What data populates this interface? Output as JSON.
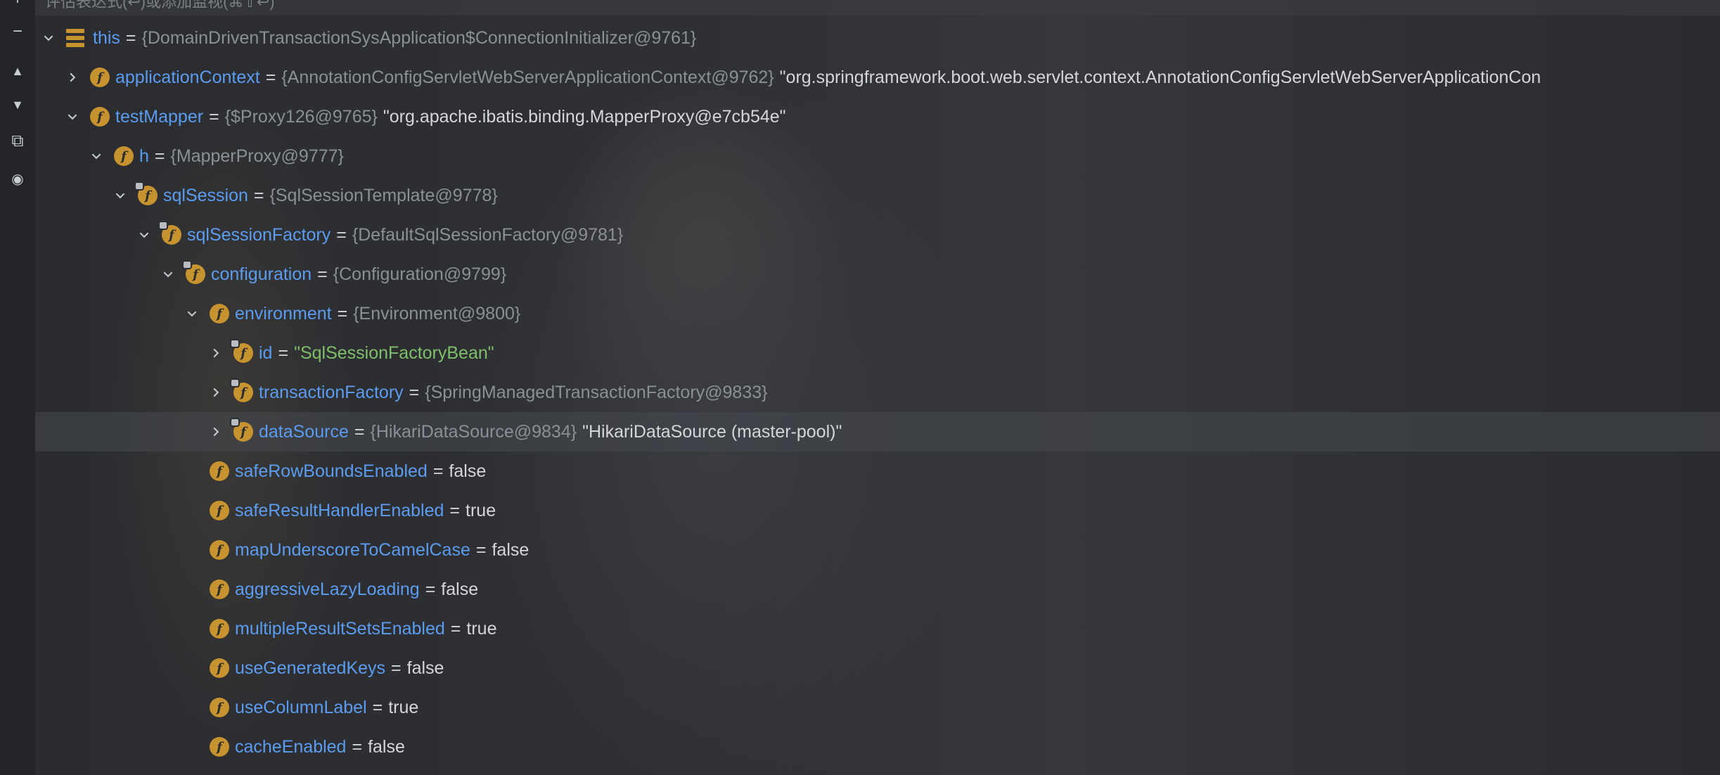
{
  "header": {
    "text": "评估表达式(↩)或添加监视(⌘⇧↩)"
  },
  "toolbar": {
    "items": [
      {
        "name": "add-watch-button",
        "glyph": "+"
      },
      {
        "name": "remove-watch-button",
        "glyph": "−"
      },
      {
        "name": "move-up-button",
        "glyph": "▲"
      },
      {
        "name": "move-down-button",
        "glyph": "▼"
      },
      {
        "name": "duplicate-watch-button",
        "glyph": "⧉"
      },
      {
        "name": "view-options-button",
        "glyph": "◉"
      }
    ]
  },
  "tree": {
    "rows": [
      {
        "depth": 0,
        "chevron": "down",
        "icon": "stack",
        "name": "this",
        "eq": "=",
        "ref": "{DomainDrivenTransactionSysApplication$ConnectionInitializer@9761}",
        "str": "",
        "desc": ""
      },
      {
        "depth": 1,
        "chevron": "right",
        "icon": "field",
        "name": "applicationContext",
        "eq": "=",
        "ref": "{AnnotationConfigServletWebServerApplicationContext@9762}",
        "str": "",
        "desc": "\"org.springframework.boot.web.servlet.context.AnnotationConfigServletWebServerApplicationCon"
      },
      {
        "depth": 1,
        "chevron": "down",
        "icon": "field",
        "name": "testMapper",
        "eq": "=",
        "ref": "{$Proxy126@9765}",
        "str": "",
        "desc": "\"org.apache.ibatis.binding.MapperProxy@e7cb54e\""
      },
      {
        "depth": 2,
        "chevron": "down",
        "icon": "field",
        "name": "h",
        "eq": "=",
        "ref": "{MapperProxy@9777}",
        "str": "",
        "desc": ""
      },
      {
        "depth": 3,
        "chevron": "down",
        "icon": "field-locked",
        "name": "sqlSession",
        "eq": "=",
        "ref": "{SqlSessionTemplate@9778}",
        "str": "",
        "desc": ""
      },
      {
        "depth": 4,
        "chevron": "down",
        "icon": "field-locked",
        "name": "sqlSessionFactory",
        "eq": "=",
        "ref": "{DefaultSqlSessionFactory@9781}",
        "str": "",
        "desc": ""
      },
      {
        "depth": 5,
        "chevron": "down",
        "icon": "field-locked",
        "name": "configuration",
        "eq": "=",
        "ref": "{Configuration@9799}",
        "str": "",
        "desc": ""
      },
      {
        "depth": 6,
        "chevron": "down",
        "icon": "field",
        "name": "environment",
        "eq": "=",
        "ref": "{Environment@9800}",
        "str": "",
        "desc": ""
      },
      {
        "depth": 7,
        "chevron": "right",
        "icon": "field-locked",
        "name": "id",
        "eq": "=",
        "ref": "",
        "str": "\"SqlSessionFactoryBean\"",
        "desc": ""
      },
      {
        "depth": 7,
        "chevron": "right",
        "icon": "field-locked",
        "name": "transactionFactory",
        "eq": "=",
        "ref": "{SpringManagedTransactionFactory@9833}",
        "str": "",
        "desc": ""
      },
      {
        "depth": 7,
        "chevron": "right",
        "icon": "field-locked",
        "name": "dataSource",
        "eq": "=",
        "ref": "{HikariDataSource@9834}",
        "str": "",
        "desc": "\"HikariDataSource (master-pool)\"",
        "selected": true
      },
      {
        "depth": 6,
        "chevron": "none",
        "icon": "field",
        "name": "safeRowBoundsEnabled",
        "eq": "=",
        "ref": "",
        "str": "",
        "desc": "false"
      },
      {
        "depth": 6,
        "chevron": "none",
        "icon": "field",
        "name": "safeResultHandlerEnabled",
        "eq": "=",
        "ref": "",
        "str": "",
        "desc": "true"
      },
      {
        "depth": 6,
        "chevron": "none",
        "icon": "field",
        "name": "mapUnderscoreToCamelCase",
        "eq": "=",
        "ref": "",
        "str": "",
        "desc": "false"
      },
      {
        "depth": 6,
        "chevron": "none",
        "icon": "field",
        "name": "aggressiveLazyLoading",
        "eq": "=",
        "ref": "",
        "str": "",
        "desc": "false"
      },
      {
        "depth": 6,
        "chevron": "none",
        "icon": "field",
        "name": "multipleResultSetsEnabled",
        "eq": "=",
        "ref": "",
        "str": "",
        "desc": "true"
      },
      {
        "depth": 6,
        "chevron": "none",
        "icon": "field",
        "name": "useGeneratedKeys",
        "eq": "=",
        "ref": "",
        "str": "",
        "desc": "false"
      },
      {
        "depth": 6,
        "chevron": "none",
        "icon": "field",
        "name": "useColumnLabel",
        "eq": "=",
        "ref": "",
        "str": "",
        "desc": "true"
      },
      {
        "depth": 6,
        "chevron": "none",
        "icon": "field",
        "name": "cacheEnabled",
        "eq": "=",
        "ref": "",
        "str": "",
        "desc": "false"
      }
    ]
  },
  "colors": {
    "field_name": "#5b9cf0",
    "field_icon": "#c7932e",
    "string_value": "#7fbf6a",
    "reference": "#8c8f95"
  }
}
